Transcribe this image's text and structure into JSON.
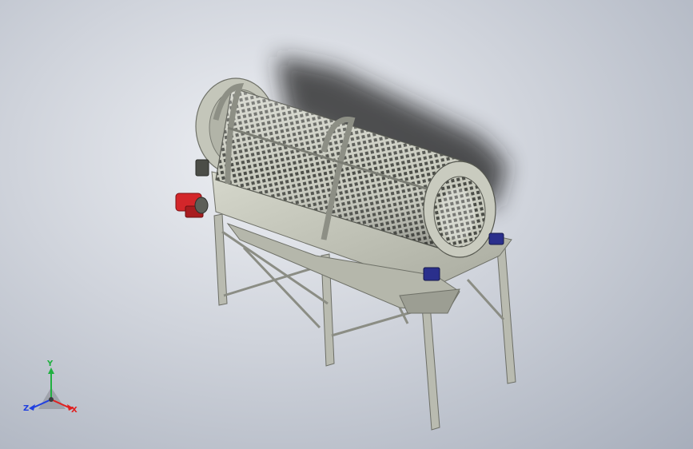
{
  "viewport": {
    "background_top": "#eef0f4",
    "background_bottom": "#a7aebb"
  },
  "model": {
    "body_color": "#c9cbbf",
    "body_shade": "#9fa196",
    "mesh_color": "#4b4d47",
    "motor_color": "#d3262a",
    "bearing_color": "#2a2f8c",
    "shadow_color": "#1e1e1e"
  },
  "triad": {
    "x_label": "X",
    "y_label": "Y",
    "z_label": "Z",
    "x_color": "#e02020",
    "y_color": "#20b040",
    "z_color": "#2040e0"
  }
}
